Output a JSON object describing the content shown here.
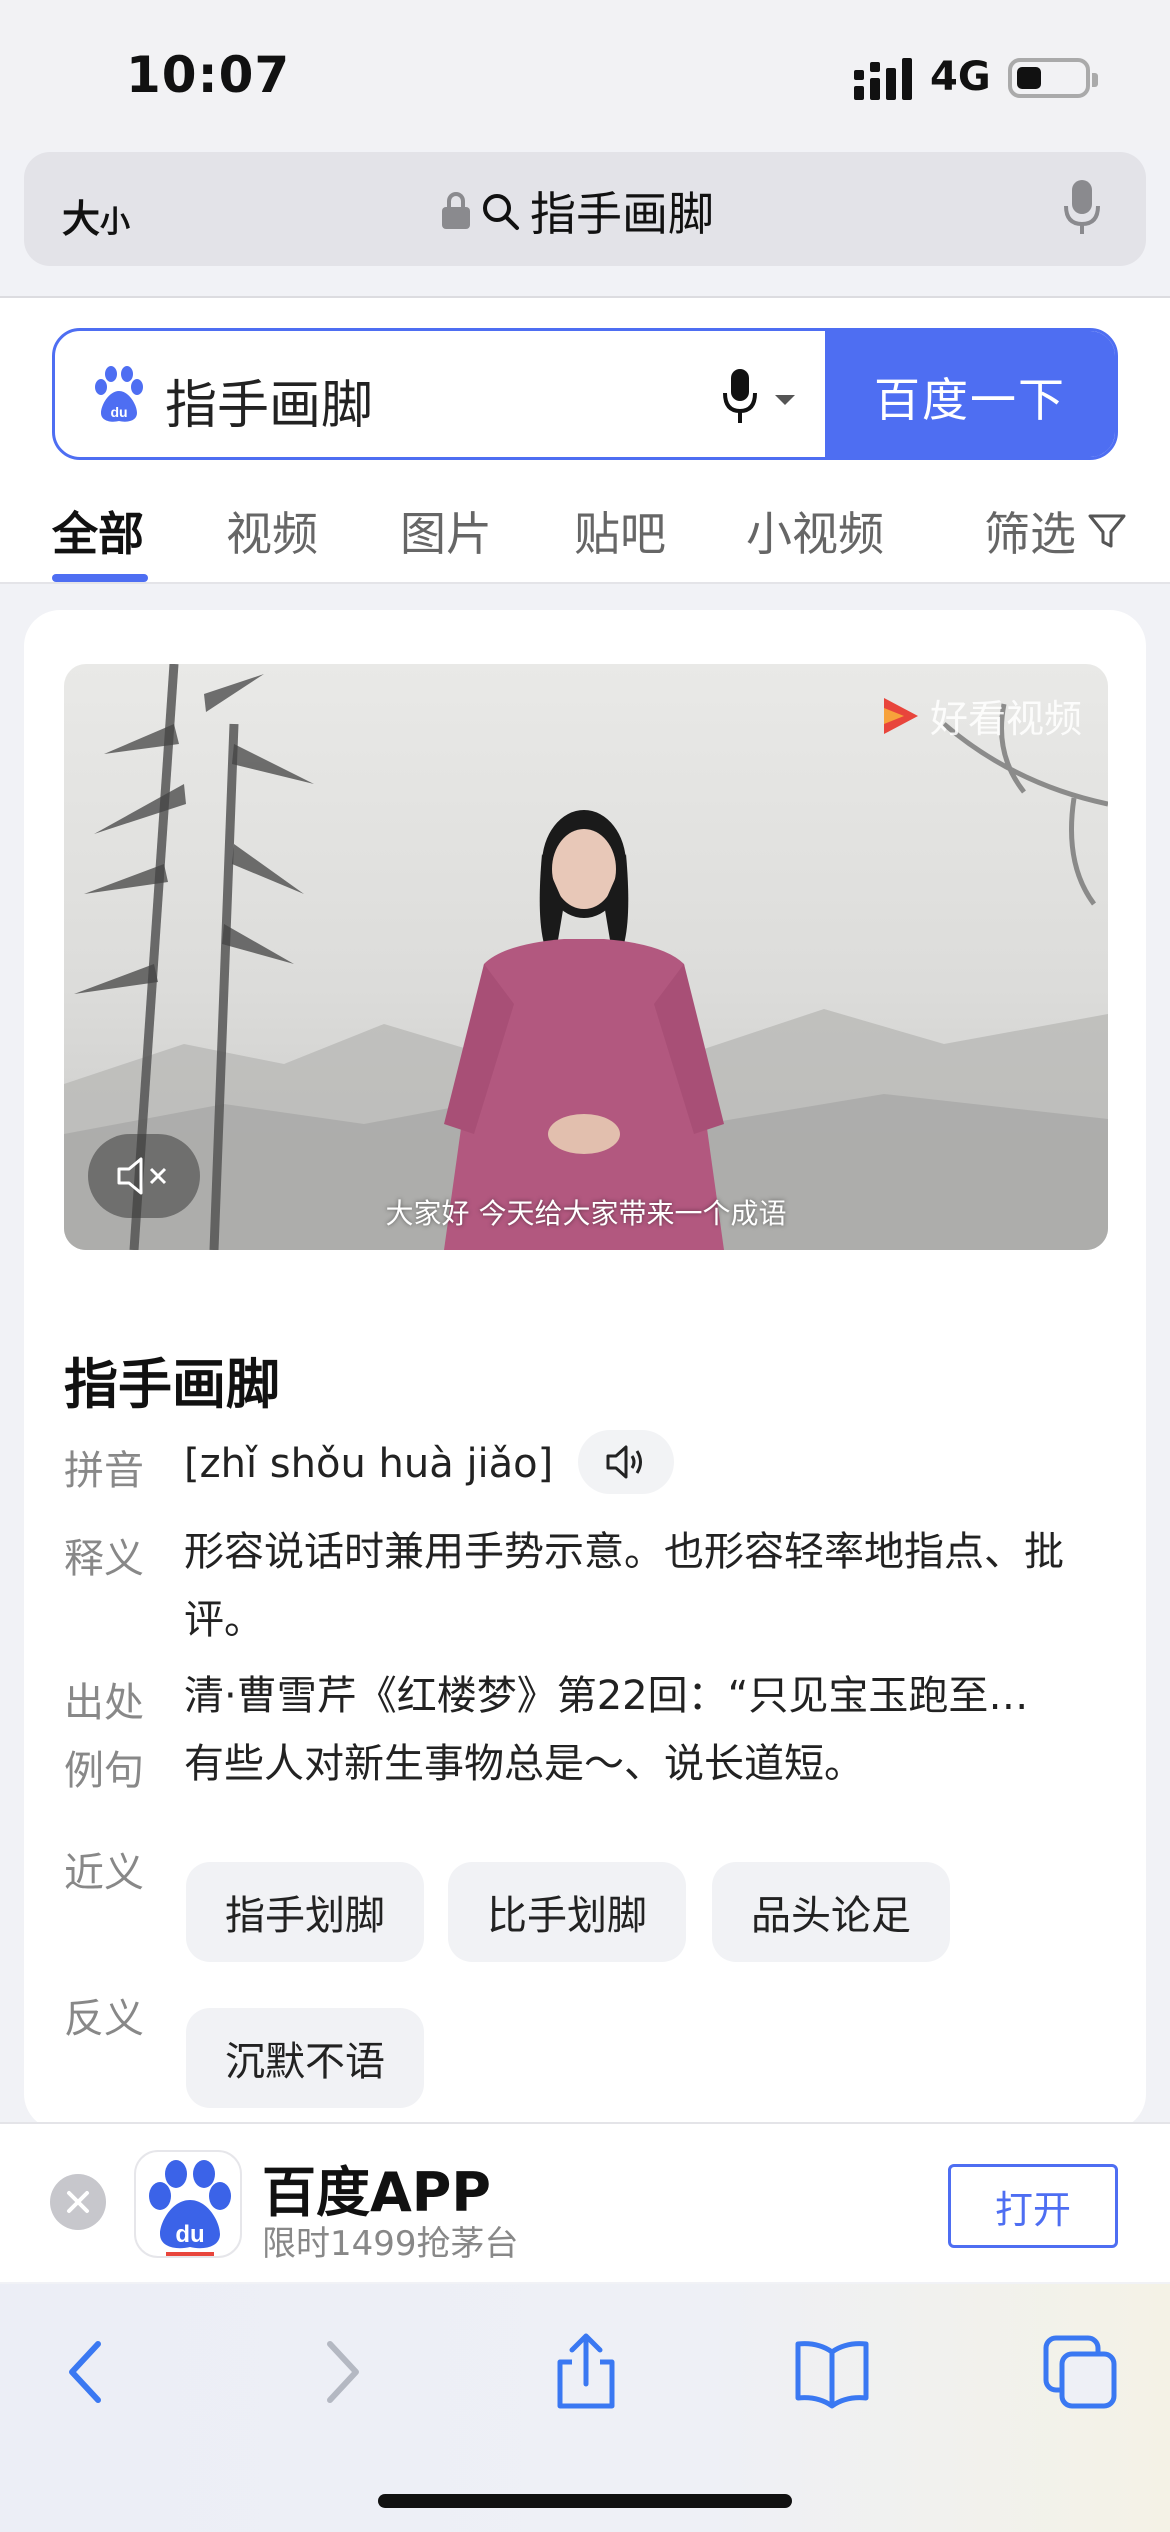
{
  "status_bar": {
    "time": "10:07",
    "network": "4G"
  },
  "url_bar": {
    "size_label": "大",
    "size_label_small": "小",
    "query": "指手画脚"
  },
  "search": {
    "query": "指手画脚",
    "button_label": "百度一下"
  },
  "tabs": [
    {
      "label": "全部",
      "active": true
    },
    {
      "label": "视频"
    },
    {
      "label": "图片"
    },
    {
      "label": "贴吧"
    },
    {
      "label": "小视频"
    }
  ],
  "filter_label": "筛选",
  "video": {
    "watermark": "好看视频",
    "caption": "大家好 今天给大家带来一个成语"
  },
  "idiom": {
    "title": "指手画脚",
    "pinyin_label": "拼音",
    "pinyin": "[zhǐ shǒu huà jiǎo]",
    "meaning_label": "释义",
    "meaning": "形容说话时兼用手势示意。也形容轻率地指点、批评。",
    "source_label": "出处",
    "source": "清·曹雪芹《红楼梦》第22回：“只见宝玉跑至…",
    "example_label": "例句",
    "example": "有些人对新生事物总是～、说长道短。",
    "synonyms_label": "近义",
    "synonyms": [
      "指手划脚",
      "比手划脚",
      "品头论足"
    ],
    "antonyms_label": "反义",
    "antonyms": [
      "沉默不语"
    ]
  },
  "app_banner": {
    "name": "百度APP",
    "subtitle": "限时1499抢茅台",
    "open_label": "打开"
  },
  "colors": {
    "accent": "#4e6ef2"
  }
}
